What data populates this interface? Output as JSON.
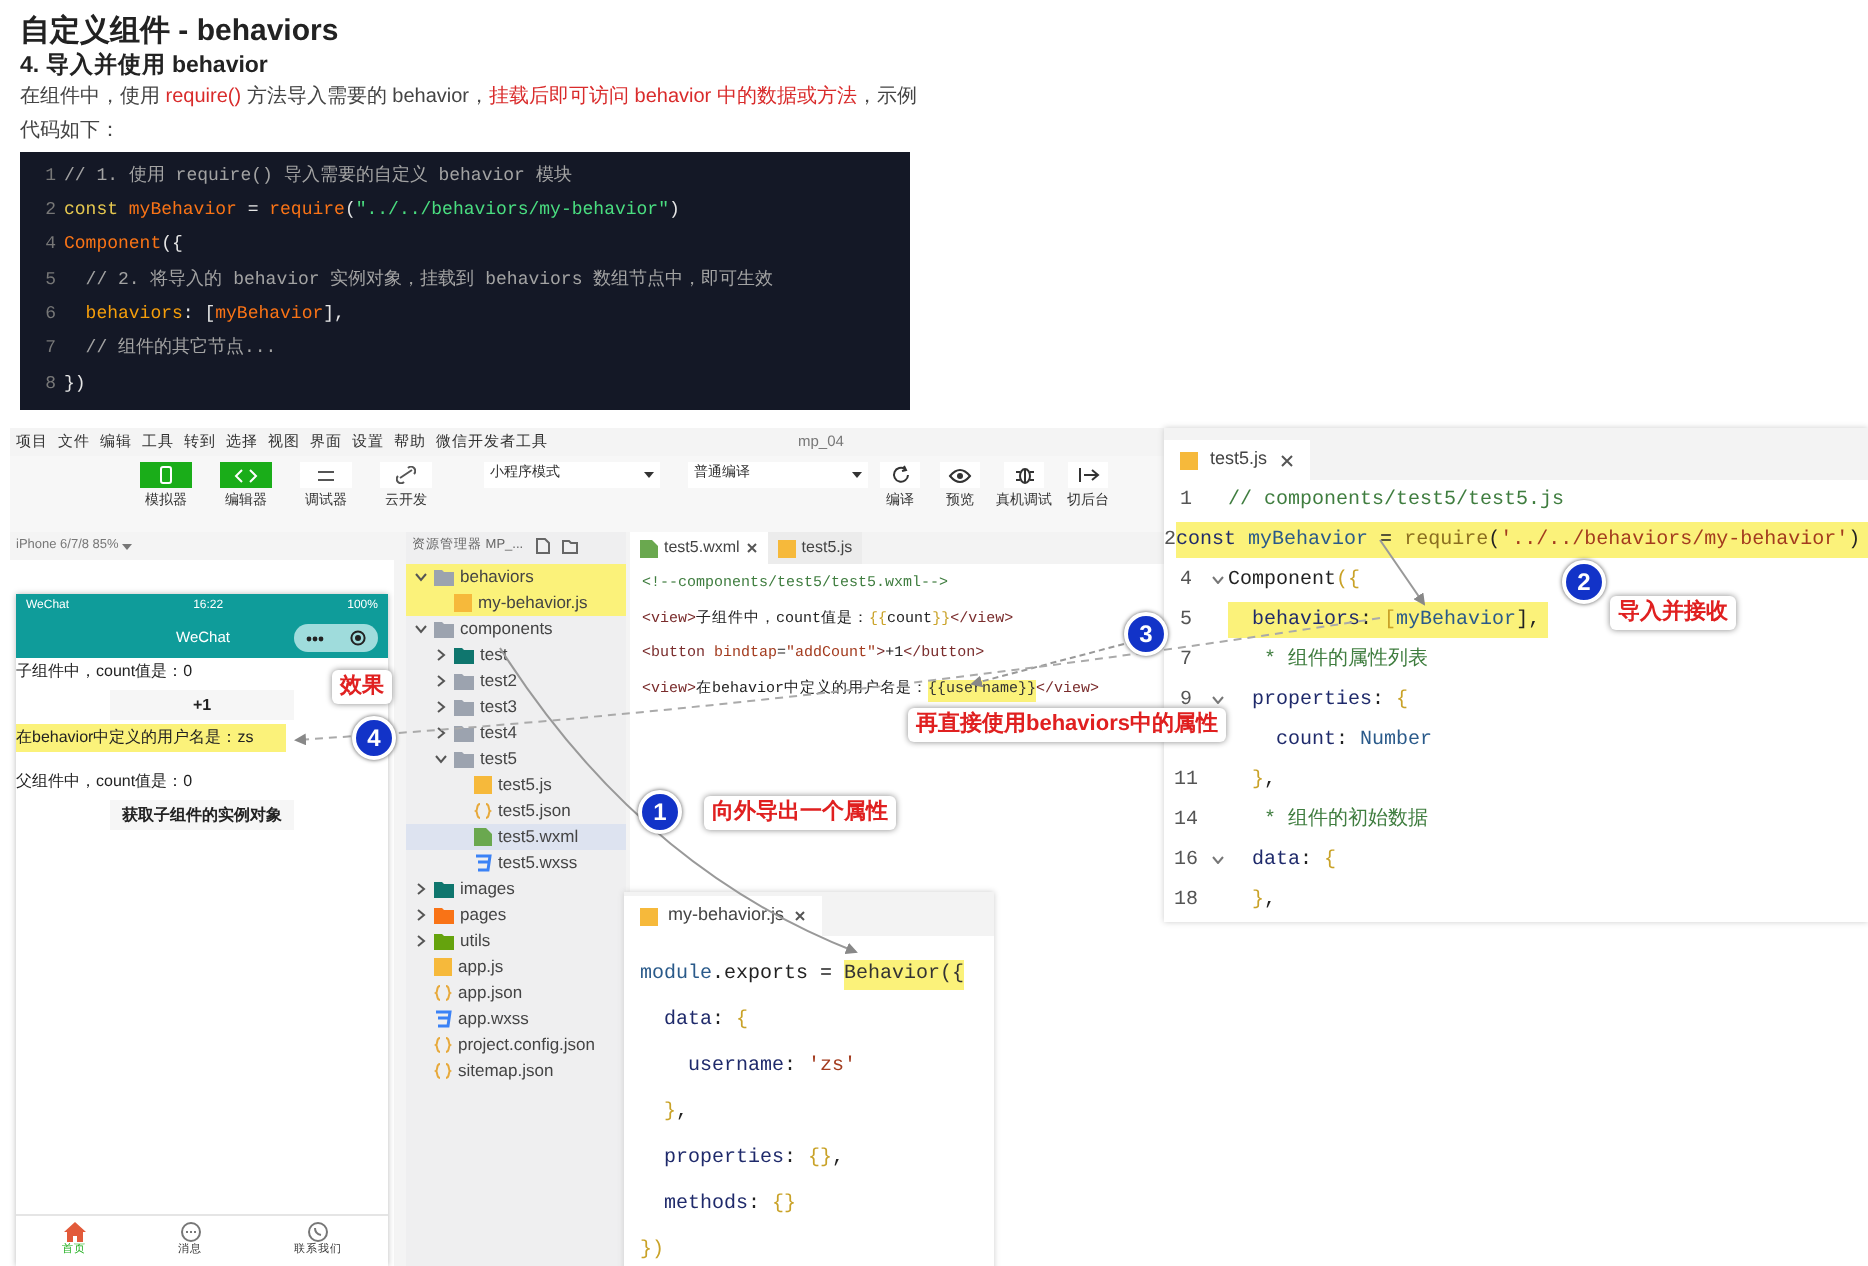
{
  "article": {
    "title": "自定义组件 - behaviors",
    "heading": "4. 导入并使用 behavior",
    "paragraph": [
      {
        "text": "在组件中，使用 ",
        "emphasis": false
      },
      {
        "text": "require()",
        "emphasis": true
      },
      {
        "text": " 方法导入需要的 behavior，",
        "emphasis": false
      },
      {
        "text": "挂载后即可访问 behavior 中的数据或方法",
        "emphasis": true
      },
      {
        "text": "，示例代码如下：",
        "emphasis": false
      }
    ],
    "code": [
      {
        "number": "1",
        "tokens": [
          {
            "text": "// 1. 使用 require() 导入需要的自定义 behavior 模块",
            "kind": "comment"
          }
        ]
      },
      {
        "number": "2",
        "tokens": [
          {
            "text": "const ",
            "kind": "keyword"
          },
          {
            "text": "myBehavior",
            "kind": "name"
          },
          {
            "text": " = ",
            "kind": "plain"
          },
          {
            "text": "require",
            "kind": "call"
          },
          {
            "text": "(",
            "kind": "plain"
          },
          {
            "text": "\"../../behaviors/my-behavior\"",
            "kind": "string"
          },
          {
            "text": ")",
            "kind": "plain"
          }
        ]
      },
      {
        "number": "4",
        "tokens": [
          {
            "text": "Component",
            "kind": "call"
          },
          {
            "text": "({",
            "kind": "plain"
          }
        ]
      },
      {
        "number": "5",
        "tokens": [
          {
            "text": "  // 2. 将导入的 behavior 实例对象，挂载到 behaviors 数组节点中，即可生效",
            "kind": "comment"
          }
        ]
      },
      {
        "number": "6",
        "tokens": [
          {
            "text": "  behaviors",
            "kind": "prop"
          },
          {
            "text": ": [",
            "kind": "plain"
          },
          {
            "text": "myBehavior",
            "kind": "name"
          },
          {
            "text": "],",
            "kind": "plain"
          }
        ]
      },
      {
        "number": "7",
        "tokens": [
          {
            "text": "  // 组件的其它节点...",
            "kind": "comment"
          }
        ]
      },
      {
        "number": "8",
        "tokens": [
          {
            "text": "})",
            "kind": "plain"
          }
        ]
      }
    ]
  },
  "ide": {
    "menu": [
      "项目",
      "文件",
      "编辑",
      "工具",
      "转到",
      "选择",
      "视图",
      "界面",
      "设置",
      "帮助",
      "微信开发者工具"
    ],
    "title": "mp_04",
    "toolbar": [
      {
        "label": "模拟器",
        "kind": "phone",
        "on": true
      },
      {
        "label": "编辑器",
        "kind": "code",
        "on": true
      },
      {
        "label": "调试器",
        "kind": "debug",
        "on": false
      },
      {
        "label": "云开发",
        "kind": "cloud",
        "on": false
      }
    ],
    "mode_select": "小程序模式",
    "compile_select": "普通编译",
    "actions": [
      {
        "label": "编译",
        "kind": "refresh"
      },
      {
        "label": "预览",
        "kind": "eye"
      },
      {
        "label": "真机调试",
        "kind": "bug"
      },
      {
        "label": "切后台",
        "kind": "switch"
      }
    ],
    "device": "iPhone 6/7/8 85%",
    "phone": {
      "carrier": "WeChat",
      "time": "16:22",
      "battery": "100%",
      "nav_title": "WeChat",
      "content": [
        {
          "kind": "text",
          "text": "子组件中，count值是：0",
          "highlighted": false
        },
        {
          "kind": "button",
          "text": "+1",
          "highlighted": false
        },
        {
          "kind": "text",
          "text": "在behavior中定义的用户名是：zs",
          "highlighted": true
        },
        {
          "kind": "text",
          "text": "父组件中，count值是：0",
          "highlighted": false
        },
        {
          "kind": "button",
          "text": "获取子组件的实例对象",
          "highlighted": false
        }
      ],
      "tabs": [
        {
          "label": "首页",
          "kind": "home",
          "selected": true
        },
        {
          "label": "消息",
          "kind": "chat",
          "selected": false
        },
        {
          "label": "联系我们",
          "kind": "phone",
          "selected": false
        }
      ]
    },
    "explorer": {
      "title": "资源管理器 MP_...",
      "tree": [
        {
          "label": "behaviors",
          "kind": "folder",
          "color": "#9ca3af",
          "expanded": true,
          "highlighted": true,
          "selected": false,
          "children": [
            {
              "label": "my-behavior.js",
              "kind": "js",
              "highlighted": true,
              "selected": false
            }
          ]
        },
        {
          "label": "components",
          "kind": "folder",
          "color": "#9ca3af",
          "expanded": true,
          "highlighted": false,
          "selected": false,
          "children": [
            {
              "label": "test",
              "kind": "folder",
              "color": "#0f766e",
              "expanded": false,
              "highlighted": false,
              "selected": false
            },
            {
              "label": "test2",
              "kind": "folder",
              "color": "#9ca3af",
              "expanded": false,
              "highlighted": false,
              "selected": false
            },
            {
              "label": "test3",
              "kind": "folder",
              "color": "#9ca3af",
              "expanded": false,
              "highlighted": false,
              "selected": false
            },
            {
              "label": "test4",
              "kind": "folder",
              "color": "#9ca3af",
              "expanded": false,
              "highlighted": false,
              "selected": false
            },
            {
              "label": "test5",
              "kind": "folder",
              "color": "#9ca3af",
              "expanded": true,
              "highlighted": false,
              "selected": false,
              "children": [
                {
                  "label": "test5.js",
                  "kind": "js",
                  "highlighted": false,
                  "selected": false
                },
                {
                  "label": "test5.json",
                  "kind": "json",
                  "highlighted": false,
                  "selected": false
                },
                {
                  "label": "test5.wxml",
                  "kind": "wxml",
                  "highlighted": false,
                  "selected": true
                },
                {
                  "label": "test5.wxss",
                  "kind": "wxss",
                  "highlighted": false,
                  "selected": false
                }
              ]
            }
          ]
        },
        {
          "label": "images",
          "kind": "folder",
          "color": "#0f766e",
          "expanded": false,
          "highlighted": false,
          "selected": false
        },
        {
          "label": "pages",
          "kind": "folder",
          "color": "#f97316",
          "expanded": false,
          "highlighted": false,
          "selected": false
        },
        {
          "label": "utils",
          "kind": "folder",
          "color": "#65a30d",
          "expanded": false,
          "highlighted": false,
          "selected": false
        },
        {
          "label": "app.js",
          "kind": "js",
          "highlighted": false,
          "selected": false
        },
        {
          "label": "app.json",
          "kind": "json",
          "highlighted": false,
          "selected": false
        },
        {
          "label": "app.wxss",
          "kind": "wxss",
          "highlighted": false,
          "selected": false
        },
        {
          "label": "project.config.json",
          "kind": "json",
          "highlighted": false,
          "selected": false
        },
        {
          "label": "sitemap.json",
          "kind": "json",
          "highlighted": false,
          "selected": false
        }
      ]
    },
    "editor": {
      "tabs": [
        {
          "label": "test5.wxml",
          "kind": "wxml",
          "selected": true
        },
        {
          "label": "test5.js",
          "kind": "js",
          "selected": false
        }
      ],
      "lines": [
        {
          "highlighted": false,
          "tokens": [
            {
              "text": "<!--components/test5/test5.wxml-->",
              "kind": "comment"
            }
          ]
        },
        {
          "highlighted": false,
          "tokens": [
            {
              "text": "<view>",
              "kind": "tag"
            },
            {
              "text": "子组件中，count值是：",
              "kind": "plain"
            },
            {
              "text": "{{",
              "kind": "brace"
            },
            {
              "text": "count",
              "kind": "plain"
            },
            {
              "text": "}}",
              "kind": "brace"
            },
            {
              "text": "</view>",
              "kind": "tag"
            }
          ]
        },
        {
          "highlighted": false,
          "tokens": [
            {
              "text": "<button ",
              "kind": "tag"
            },
            {
              "text": "bindtap",
              "kind": "attr"
            },
            {
              "text": "=",
              "kind": "plain"
            },
            {
              "text": "\"addCount\"",
              "kind": "string"
            },
            {
              "text": ">",
              "kind": "tag"
            },
            {
              "text": "+1",
              "kind": "plain"
            },
            {
              "text": "</button>",
              "kind": "tag"
            }
          ]
        },
        {
          "highlighted": false,
          "tokens": [
            {
              "text": "<view>",
              "kind": "tag"
            },
            {
              "text": "在behavior中定义的用户名是：",
              "kind": "plain"
            },
            {
              "text": "{{username}}",
              "kind": "marked"
            },
            {
              "text": "</view>",
              "kind": "tag"
            }
          ]
        }
      ]
    }
  },
  "js_panel": {
    "tab": "test5.js",
    "lines": [
      {
        "number": "1",
        "fold": false,
        "highlighted": false,
        "tokens": [
          {
            "text": "// components/test5/test5.js",
            "kind": "comment"
          }
        ]
      },
      {
        "number": "2",
        "fold": false,
        "highlighted": true,
        "tokens": [
          {
            "text": "const ",
            "kind": "keyword"
          },
          {
            "text": "myBehavior",
            "kind": "name"
          },
          {
            "text": " = ",
            "kind": "plain"
          },
          {
            "text": "require",
            "kind": "call"
          },
          {
            "text": "(",
            "kind": "plain"
          },
          {
            "text": "'../../behaviors/my-behavior'",
            "kind": "string"
          },
          {
            "text": ")",
            "kind": "plain"
          }
        ]
      },
      {
        "number": "4",
        "fold": true,
        "highlighted": false,
        "tokens": [
          {
            "text": "Component",
            "kind": "plain"
          },
          {
            "text": "({",
            "kind": "brace"
          }
        ]
      },
      {
        "number": "5",
        "fold": false,
        "highlighted": true,
        "tokens": [
          {
            "text": "  behaviors",
            "kind": "prop"
          },
          {
            "text": ": ",
            "kind": "plain"
          },
          {
            "text": "[",
            "kind": "brace"
          },
          {
            "text": "myBehavior",
            "kind": "name"
          },
          {
            "text": "],",
            "kind": "plain"
          }
        ]
      },
      {
        "number": "7",
        "fold": false,
        "highlighted": false,
        "tokens": [
          {
            "text": "   * 组件的属性列表",
            "kind": "comment"
          }
        ]
      },
      {
        "number": "9",
        "fold": true,
        "highlighted": false,
        "tokens": [
          {
            "text": "  properties",
            "kind": "prop"
          },
          {
            "text": ": ",
            "kind": "plain"
          },
          {
            "text": "{",
            "kind": "brace"
          }
        ]
      },
      {
        "fold": false,
        "highlighted": false,
        "tokens": [
          {
            "text": "    count",
            "kind": "prop"
          },
          {
            "text": ": ",
            "kind": "plain"
          },
          {
            "text": "Number",
            "kind": "name"
          }
        ]
      },
      {
        "number": "11",
        "fold": false,
        "highlighted": false,
        "tokens": [
          {
            "text": "  }",
            "kind": "brace"
          },
          {
            "text": ",",
            "kind": "plain"
          }
        ]
      },
      {
        "number": "14",
        "fold": false,
        "highlighted": false,
        "tokens": [
          {
            "text": "   * 组件的初始数据",
            "kind": "comment"
          }
        ]
      },
      {
        "number": "16",
        "fold": true,
        "highlighted": false,
        "tokens": [
          {
            "text": "  data",
            "kind": "prop"
          },
          {
            "text": ": ",
            "kind": "plain"
          },
          {
            "text": "{",
            "kind": "brace"
          }
        ]
      },
      {
        "number": "18",
        "fold": false,
        "highlighted": false,
        "tokens": [
          {
            "text": "  }",
            "kind": "brace"
          },
          {
            "text": ",",
            "kind": "plain"
          }
        ]
      }
    ]
  },
  "behavior_panel": {
    "tab": "my-behavior.js",
    "lines": [
      {
        "tokens": [
          {
            "text": "module",
            "kind": "name"
          },
          {
            "text": ".exports = ",
            "kind": "plain"
          },
          {
            "text": "Behavior({",
            "kind": "marked"
          }
        ]
      },
      {
        "tokens": [
          {
            "text": "  data",
            "kind": "prop"
          },
          {
            "text": ": ",
            "kind": "plain"
          },
          {
            "text": "{",
            "kind": "brace"
          }
        ]
      },
      {
        "tokens": [
          {
            "text": "    username",
            "kind": "prop"
          },
          {
            "text": ": ",
            "kind": "plain"
          },
          {
            "text": "'zs'",
            "kind": "string"
          }
        ]
      },
      {
        "tokens": [
          {
            "text": "  }",
            "kind": "brace"
          },
          {
            "text": ",",
            "kind": "plain"
          }
        ]
      },
      {
        "tokens": [
          {
            "text": "  properties",
            "kind": "prop"
          },
          {
            "text": ": ",
            "kind": "plain"
          },
          {
            "text": "{}",
            "kind": "brace"
          },
          {
            "text": ",",
            "kind": "plain"
          }
        ]
      },
      {
        "tokens": [
          {
            "text": "  methods",
            "kind": "prop"
          },
          {
            "text": ": ",
            "kind": "plain"
          },
          {
            "text": "{}",
            "kind": "brace"
          }
        ]
      },
      {
        "tokens": [
          {
            "text": "})",
            "kind": "brace"
          }
        ]
      }
    ]
  },
  "annotations": [
    {
      "number": "1",
      "label": "向外导出一个属性"
    },
    {
      "number": "2",
      "label": "导入并接收"
    },
    {
      "number": "3",
      "label": "再直接使用behaviors中的属性"
    },
    {
      "number": "4",
      "label": "效果"
    }
  ]
}
